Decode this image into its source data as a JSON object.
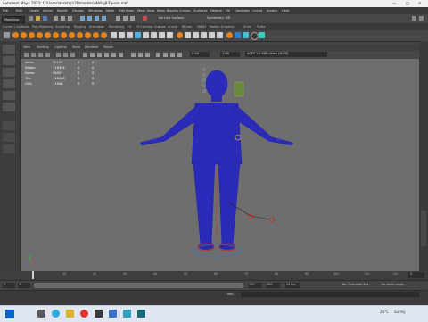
{
  "window": {
    "title": "Autodesk Maya 2023: C:\\Users\\desktop\\3D\\models\\MAY-g8-T-pose.mb*"
  },
  "menus": [
    "File",
    "Edit",
    "Create",
    "Select",
    "Modify",
    "Display",
    "Windows",
    "Mesh",
    "Edit Mesh",
    "Mesh Tools",
    "Mesh Display",
    "Curves",
    "Surfaces",
    "Deform",
    "UV",
    "Generate",
    "Cache",
    "Arnold",
    "Help"
  ],
  "status": {
    "mode": "Modeling",
    "surface_label": "No Live Surface",
    "symmetry": "Symmetry: Off"
  },
  "shelf_tabs": [
    "Curves / Surfaces",
    "Poly Modeling",
    "Sculpting",
    "Rigging",
    "Animation",
    "Rendering",
    "FX",
    "FX Caching",
    "Custom",
    "Arnold",
    "Bifrost",
    "MASH",
    "Motion Graphics",
    "XGen",
    "Turtle"
  ],
  "panel_menus": [
    "View",
    "Shading",
    "Lighting",
    "Show",
    "Renderer",
    "Panels"
  ],
  "panel_toolbar": {
    "exposure": "0.00",
    "gamma": "1.00",
    "colorspace": "ACES 1.0 SDR-video (ACES)"
  },
  "hud": {
    "rows": [
      {
        "label": "Verts:",
        "a": "59199",
        "b": "0",
        "c": "0"
      },
      {
        "label": "Edges:",
        "a": "116344",
        "b": "0",
        "c": "0"
      },
      {
        "label": "Faces:",
        "a": "58057",
        "b": "0",
        "c": "0"
      },
      {
        "label": "Tris:",
        "a": "116186",
        "b": "0",
        "c": "0"
      },
      {
        "label": "UVs:",
        "a": "71948",
        "b": "0",
        "c": "0"
      }
    ]
  },
  "timeline": {
    "current_frame": "1",
    "start": "1",
    "end": "120",
    "ticks": [
      "1",
      "10",
      "20",
      "30",
      "40",
      "50",
      "60",
      "70",
      "80",
      "90",
      "100",
      "110",
      "120"
    ]
  },
  "range": {
    "start": "1",
    "inner_start": "1",
    "inner_end": "120",
    "end": "200",
    "character_set": "No Character Set",
    "anim_layer": "No Anim Layer",
    "fps": "24 fps"
  },
  "cmdline": {
    "lang": "MEL"
  },
  "taskbar": {
    "weather": "26°C",
    "weather_desc": "Sunny"
  },
  "colors": {
    "wire": "#2a2ad8",
    "viewport_bg": "#6e6e6e",
    "accent": "#e08a1e"
  }
}
